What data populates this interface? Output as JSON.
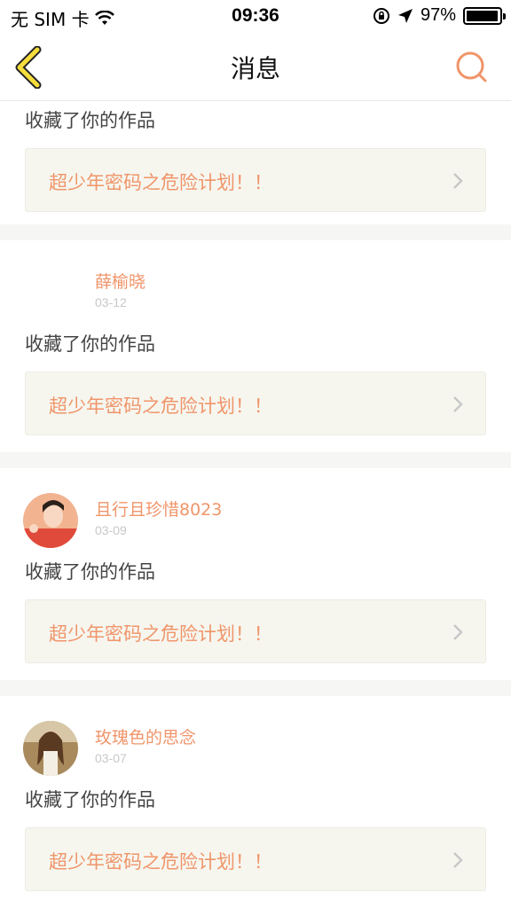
{
  "status": {
    "carrier": "无 SIM 卡",
    "time": "09:36",
    "battery": "97%",
    "battery_level": 0.97
  },
  "nav": {
    "title": "消息",
    "back_icon": "chevron-left-icon",
    "search_icon": "search-icon"
  },
  "messages": [
    {
      "action": "收藏了你的作品",
      "work_title": "超少年密码之危险计划！！"
    },
    {
      "user": "薛榆晓",
      "date": "03-12",
      "action": "收藏了你的作品",
      "work_title": "超少年密码之危险计划！！"
    },
    {
      "user": "且行且珍惜8023",
      "date": "03-09",
      "action": "收藏了你的作品",
      "work_title": "超少年密码之危险计划！！"
    },
    {
      "user": "玫瑰色的思念",
      "date": "03-07",
      "action": "收藏了你的作品",
      "work_title": "超少年密码之危险计划！！"
    }
  ],
  "colors": {
    "accent": "#f0956a",
    "back_icon_fill": "#f5dd3c",
    "card_bg": "#f6f6ef"
  }
}
